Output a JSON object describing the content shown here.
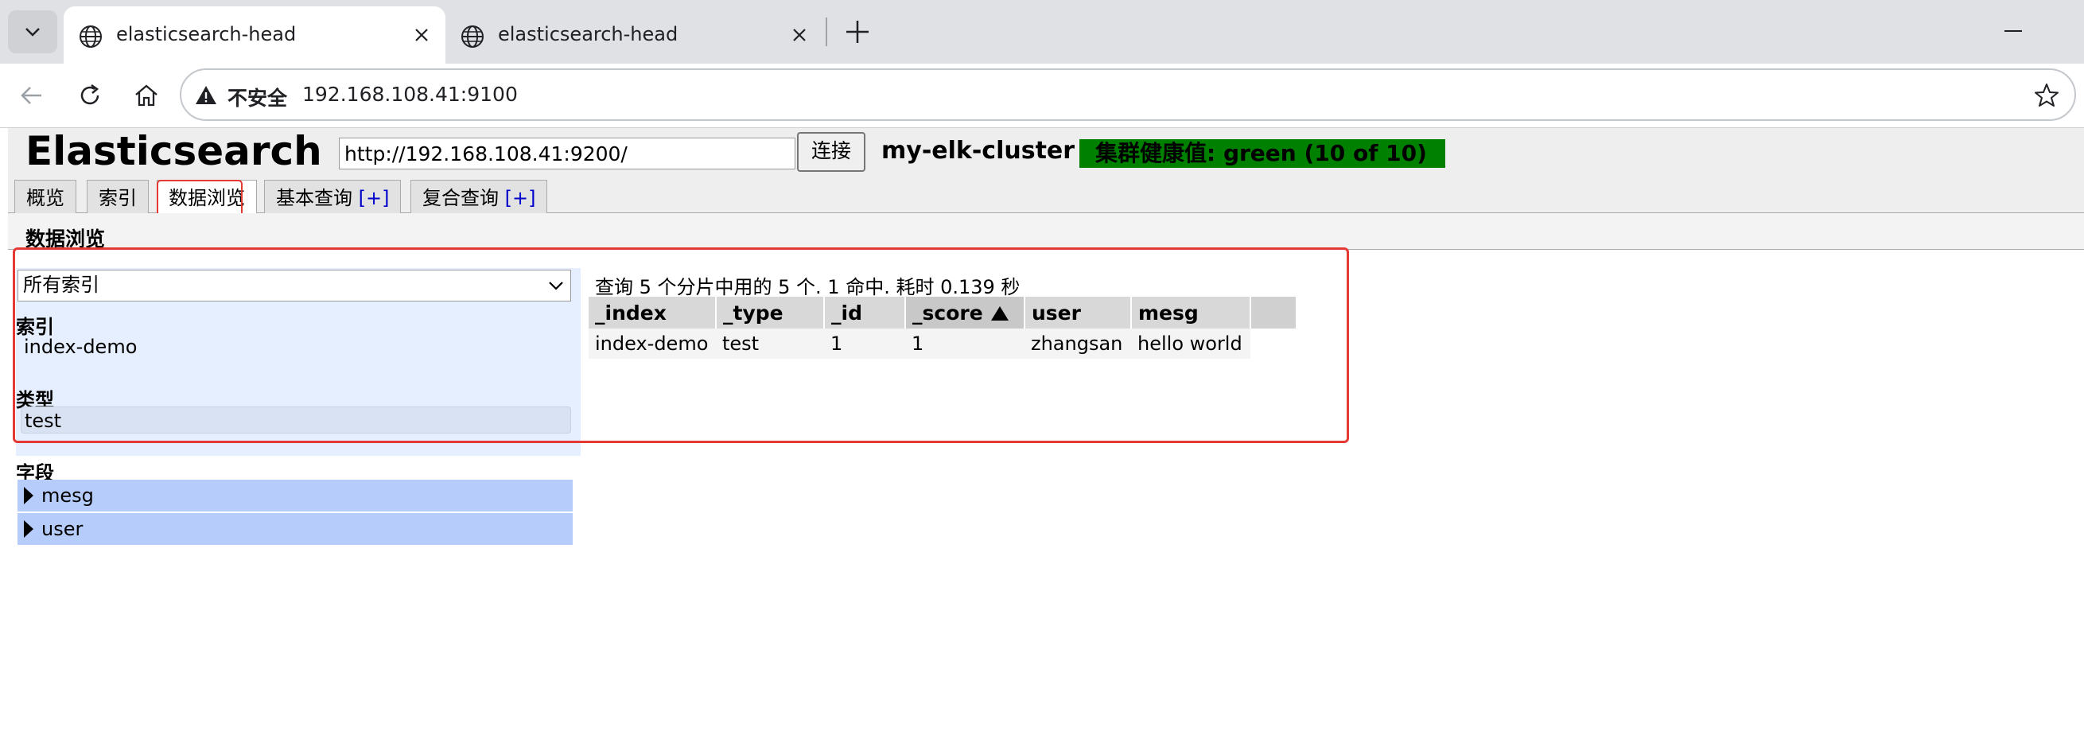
{
  "browser": {
    "tabs": [
      {
        "title": "elasticsearch-head",
        "active": true
      },
      {
        "title": "elasticsearch-head",
        "active": false
      }
    ],
    "address": {
      "security_label": "不安全",
      "url": "192.168.108.41:9100"
    }
  },
  "header": {
    "app_title": "Elasticsearch",
    "connect_url": "http://192.168.108.41:9200/",
    "connect_label": "连接",
    "cluster_name": "my-elk-cluster",
    "health": "集群健康值: green (10 of 10)",
    "health_color": "#008000"
  },
  "nav": {
    "tabs": [
      {
        "label": "概览"
      },
      {
        "label": "索引"
      },
      {
        "label": "数据浏览",
        "active": true
      },
      {
        "label": "基本查询",
        "plus": "[+]"
      },
      {
        "label": "复合查询",
        "plus": "[+]"
      }
    ]
  },
  "browse": {
    "section_title": "数据浏览",
    "index_select": "所有索引",
    "index_label": "索引",
    "index_items": [
      "index-demo"
    ],
    "type_label": "类型",
    "type_items": [
      "test"
    ],
    "field_label": "字段",
    "field_items": [
      "mesg",
      "user"
    ],
    "summary": "查询 5 个分片中用的 5 个. 1 命中. 耗时 0.139 秒",
    "columns": [
      "_index",
      "_type",
      "_id",
      "_score",
      "user",
      "mesg"
    ],
    "sorted_column": "_score",
    "rows": [
      [
        "index-demo",
        "test",
        "1",
        "1",
        "zhangsan",
        "hello world"
      ]
    ]
  },
  "colors": {
    "highlight_outline": "#e53935",
    "sidebar_bg": "#e6efff",
    "field_row_bg": "#b6cdfc"
  }
}
